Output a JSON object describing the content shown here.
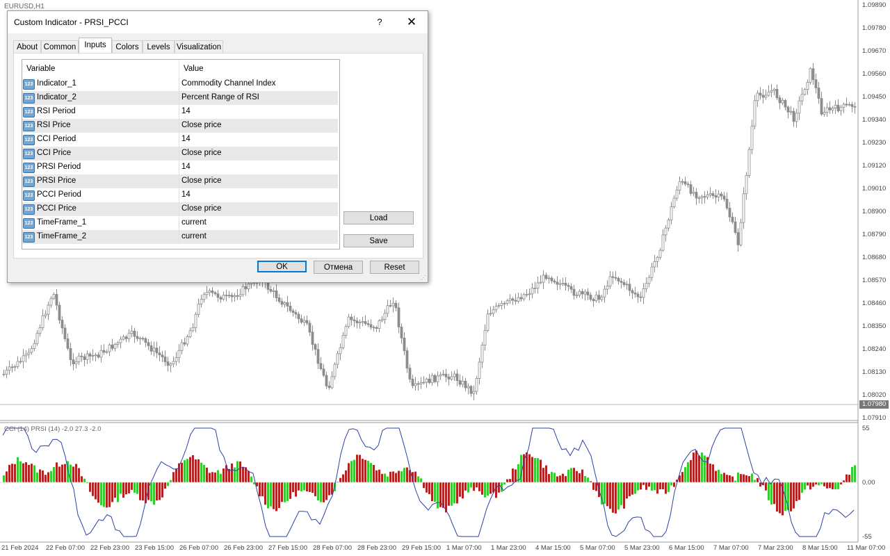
{
  "chart": {
    "symbol": "EURUSD,H1",
    "price_axis": [
      "1.09890",
      "1.09780",
      "1.09670",
      "1.09560",
      "1.09450",
      "1.09340",
      "1.09230",
      "1.09120",
      "1.09010",
      "1.08900",
      "1.08790",
      "1.08680",
      "1.08570",
      "1.08460",
      "1.08350",
      "1.08240",
      "1.08130",
      "1.08020",
      "1.07910"
    ],
    "current_price": "1.07980",
    "time_axis": [
      "21 Feb 2024",
      "22 Feb 07:00",
      "22 Feb 23:00",
      "23 Feb 15:00",
      "26 Feb 07:00",
      "26 Feb 23:00",
      "27 Feb 15:00",
      "28 Feb 07:00",
      "28 Feb 23:00",
      "29 Feb 15:00",
      "1 Mar 07:00",
      "1 Mar 23:00",
      "4 Mar 15:00",
      "5 Mar 07:00",
      "5 Mar 23:00",
      "6 Mar 15:00",
      "7 Mar 07:00",
      "7 Mar 23:00",
      "8 Mar 15:00",
      "11 Mar 07:00"
    ],
    "candle_color": "#8c8c8c",
    "indicator": {
      "label": "CCI  (14) PRSI  (14) -2.0 27.3 -2.0",
      "axis": [
        "55",
        "0.00",
        "-55"
      ],
      "line_color": "#2b3fa8",
      "up_color": "#33cc33",
      "down_color": "#b22222"
    }
  },
  "dialog": {
    "title": "Custom Indicator - PRSI_PCCI",
    "help_label": "?",
    "close_label": "✕",
    "tabs": [
      {
        "label": "About"
      },
      {
        "label": "Common"
      },
      {
        "label": "Inputs",
        "active": true
      },
      {
        "label": "Colors"
      },
      {
        "label": "Levels"
      },
      {
        "label": "Visualization"
      }
    ],
    "columns": {
      "variable": "Variable",
      "value": "Value"
    },
    "icon_text": "123",
    "inputs": [
      {
        "variable": "Indicator_1",
        "value": "Commodity Channel Index"
      },
      {
        "variable": "Indicator_2",
        "value": "Percent Range of RSI"
      },
      {
        "variable": "RSI Period",
        "value": "14"
      },
      {
        "variable": "RSI Price",
        "value": "Close price"
      },
      {
        "variable": "CCI Period",
        "value": "14"
      },
      {
        "variable": "CCI Price",
        "value": "Close price"
      },
      {
        "variable": "PRSI Period",
        "value": "14"
      },
      {
        "variable": "PRSI Price",
        "value": "Close price"
      },
      {
        "variable": "PCCI Period",
        "value": "14"
      },
      {
        "variable": "PCCI Price",
        "value": "Close price"
      },
      {
        "variable": "TimeFrame_1",
        "value": "current"
      },
      {
        "variable": "TimeFrame_2",
        "value": "current"
      }
    ],
    "load_label": "Load",
    "save_label": "Save",
    "ok_label": "OK",
    "cancel_label": "Отмена",
    "reset_label": "Reset"
  }
}
